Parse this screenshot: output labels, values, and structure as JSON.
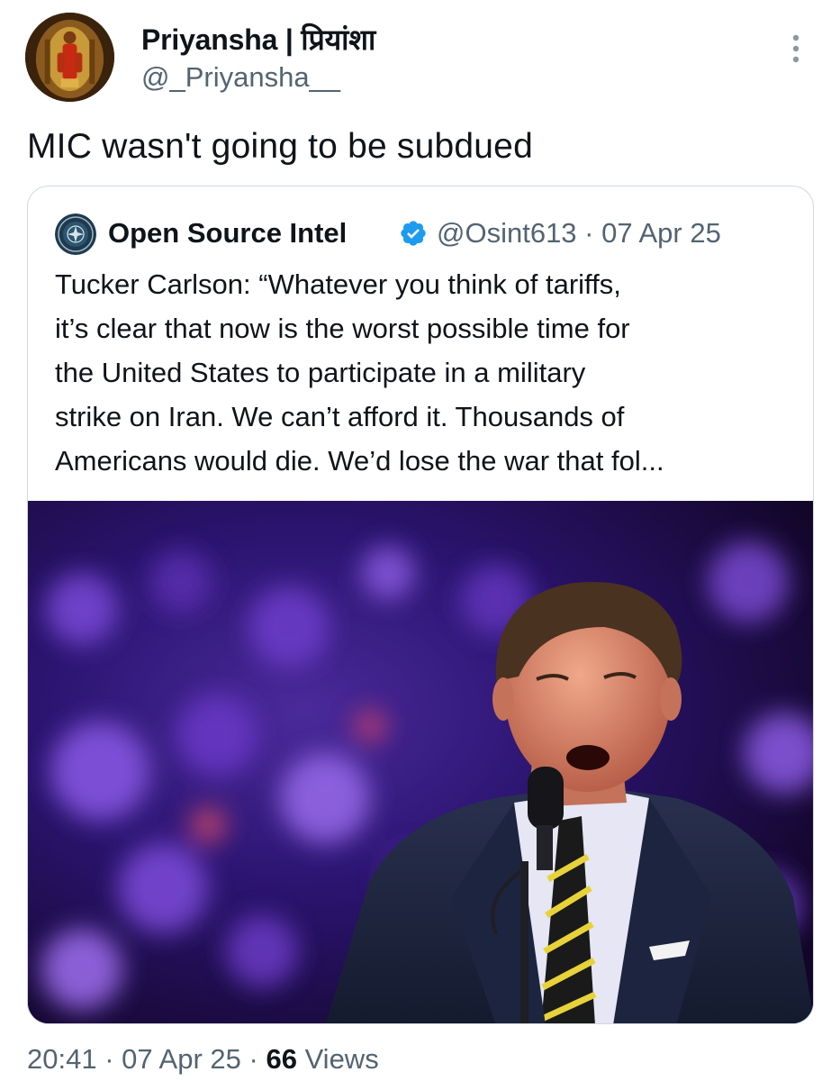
{
  "author": {
    "display_name": "Priyansha | प्रियांशा",
    "handle": "@_Priyansha__"
  },
  "tweet": {
    "text": "MIC wasn't going to be subdued",
    "time": "20:41",
    "separator": "·",
    "date": "07 Apr 25",
    "views_count": "66",
    "views_label": "Views"
  },
  "quoted_tweet": {
    "name": "Open Source Intel",
    "handle": "@Osint613",
    "separator": "·",
    "date": "07 Apr 25",
    "text_lines": [
      "Tucker Carlson: “Whatever you think of tariffs,",
      "it’s clear that now is the worst possible time for",
      "the United States to participate in a military",
      "strike on Iran. We can’t afford it. Thousands of",
      "Americans would die. We’d lose the war that fol..."
    ],
    "verified": true
  },
  "icons": {
    "more": "more-vertical-icon",
    "verified": "verified-badge-icon"
  },
  "colors": {
    "text_primary": "#0f1419",
    "text_secondary": "#536471",
    "verified_blue": "#1d9bf0",
    "border": "#cfd9de"
  }
}
